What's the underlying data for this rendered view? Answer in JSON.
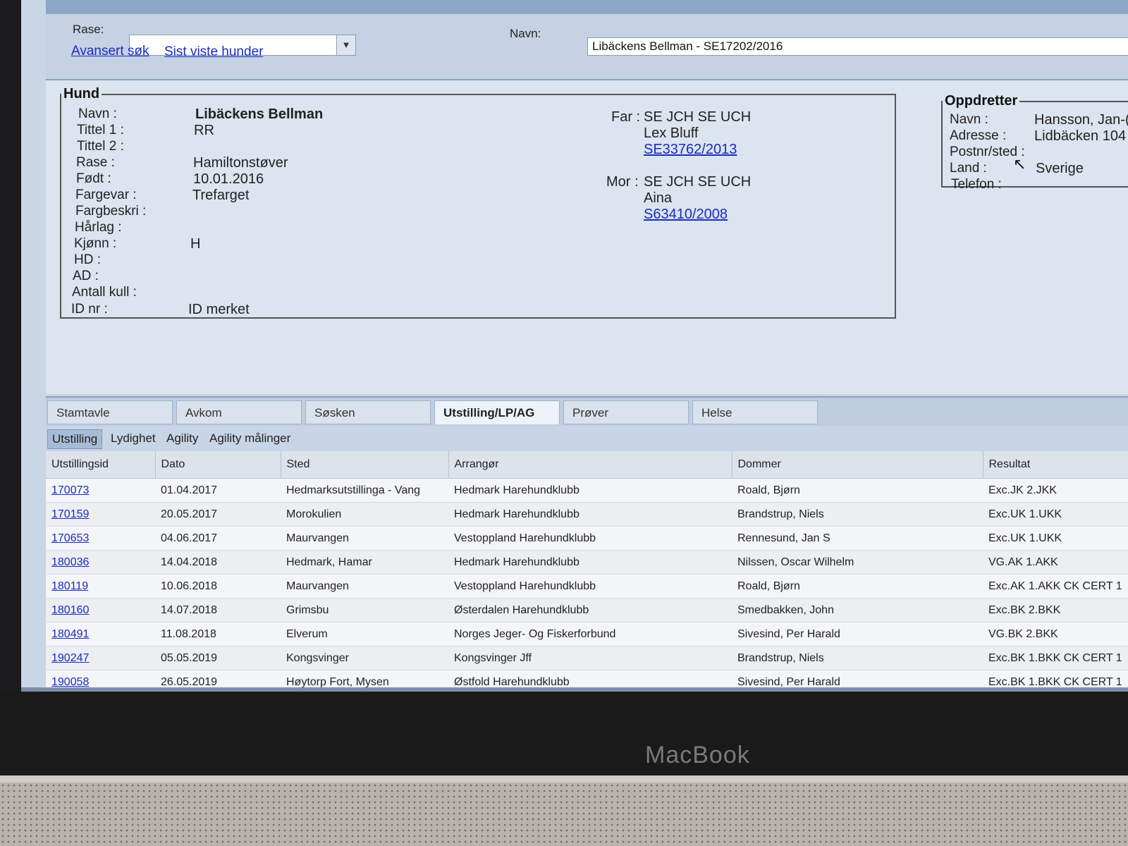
{
  "search": {
    "breed_label": "Rase:",
    "breed_value": "",
    "name_label": "Navn:",
    "name_value": "Libäckens Bellman - SE17202/2016",
    "links": [
      "Avansert søk",
      "Sist viste hunder"
    ]
  },
  "hund": {
    "legend": "Hund",
    "fields": [
      {
        "label": "Navn :",
        "value": "Libäckens Bellman"
      },
      {
        "label": "Tittel 1 :",
        "value": "RR"
      },
      {
        "label": "Tittel 2 :",
        "value": ""
      },
      {
        "label": "Rase :",
        "value": "Hamiltonstøver"
      },
      {
        "label": "Født :",
        "value": "10.01.2016"
      },
      {
        "label": "Fargevar :",
        "value": "Trefarget"
      },
      {
        "label": "Fargbeskri :",
        "value": ""
      },
      {
        "label": "Hårlag :",
        "value": ""
      },
      {
        "label": "Kjønn :",
        "value": "H"
      },
      {
        "label": "HD :",
        "value": ""
      },
      {
        "label": "AD :",
        "value": ""
      },
      {
        "label": "Antall kull :",
        "value": ""
      },
      {
        "label": "ID nr :",
        "value": "ID merket"
      }
    ],
    "far": {
      "label": "Far :",
      "titles": "SE JCH SE UCH",
      "name": "Lex Bluff",
      "reg": "SE33762/2013"
    },
    "mor": {
      "label": "Mor :",
      "titles": "SE JCH SE UCH",
      "name": "Aina",
      "reg": "S63410/2008"
    }
  },
  "oppdretter": {
    "legend": "Oppdretter",
    "fields": [
      {
        "label": "Navn :",
        "value": "Hansson, Jan-("
      },
      {
        "label": "Adresse :",
        "value": "Lidbäcken 104"
      },
      {
        "label": "Postnr/sted :",
        "value": ""
      },
      {
        "label": "Land :",
        "value": "Sverige"
      },
      {
        "label": "Telefon :",
        "value": ""
      }
    ]
  },
  "tabs": [
    {
      "label": "Stamtavle",
      "active": false
    },
    {
      "label": "Avkom",
      "active": false
    },
    {
      "label": "Søsken",
      "active": false
    },
    {
      "label": "Utstilling/LP/AG",
      "active": true
    },
    {
      "label": "Prøver",
      "active": false
    },
    {
      "label": "Helse",
      "active": false
    }
  ],
  "subtabs": [
    {
      "label": "Utstilling",
      "active": true
    },
    {
      "label": "Lydighet",
      "active": false
    },
    {
      "label": "Agility",
      "active": false
    },
    {
      "label": "Agility målinger",
      "active": false
    }
  ],
  "table": {
    "columns": [
      "Utstillingsid",
      "Dato",
      "Sted",
      "Arrangør",
      "Dommer",
      "Resultat"
    ],
    "rows": [
      [
        "170073",
        "01.04.2017",
        "Hedmarksutstillinga - Vang",
        "Hedmark Harehundklubb",
        "Roald, Bjørn",
        "Exc.JK 2.JKK"
      ],
      [
        "170159",
        "20.05.2017",
        "Morokulien",
        "Hedmark Harehundklubb",
        "Brandstrup, Niels",
        "Exc.UK 1.UKK"
      ],
      [
        "170653",
        "04.06.2017",
        "Maurvangen",
        "Vestoppland Harehundklubb",
        "Rennesund, Jan S",
        "Exc.UK 1.UKK"
      ],
      [
        "180036",
        "14.04.2018",
        "Hedmark, Hamar",
        "Hedmark Harehundklubb",
        "Nilssen, Oscar Wilhelm",
        "VG.AK 1.AKK"
      ],
      [
        "180119",
        "10.06.2018",
        "Maurvangen",
        "Vestoppland Harehundklubb",
        "Roald, Bjørn",
        "Exc.AK 1.AKK CK CERT 1"
      ],
      [
        "180160",
        "14.07.2018",
        "Grimsbu",
        "Østerdalen Harehundklubb",
        "Smedbakken, John",
        "Exc.BK 2.BKK"
      ],
      [
        "180491",
        "11.08.2018",
        "Elverum",
        "Norges Jeger- Og Fiskerforbund",
        "Sivesind, Per Harald",
        "VG.BK 2.BKK"
      ],
      [
        "190247",
        "05.05.2019",
        "Kongsvinger",
        "Kongsvinger Jff",
        "Brandstrup, Niels",
        "Exc.BK 1.BKK CK CERT 1"
      ],
      [
        "190058",
        "26.05.2019",
        "Høytorp Fort, Mysen",
        "Østfold Harehundklubb",
        "Sivesind, Per Harald",
        "Exc.BK 1.BKK CK CERT 1"
      ]
    ]
  },
  "device": {
    "brand": "MacBook"
  }
}
